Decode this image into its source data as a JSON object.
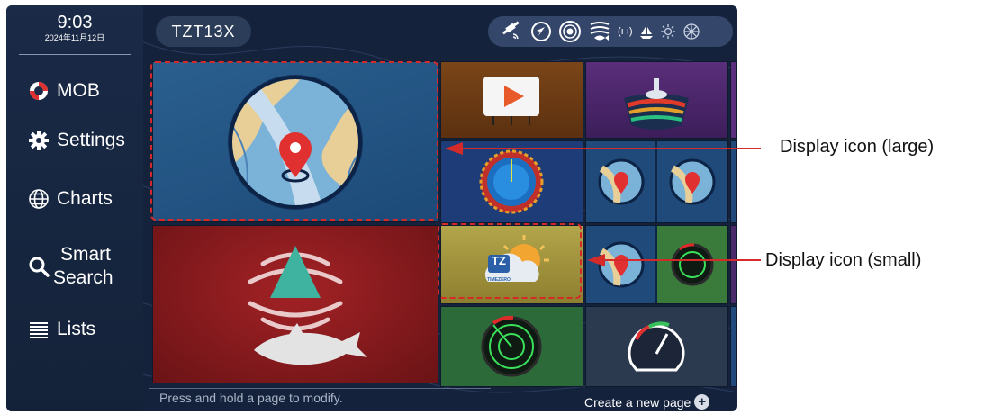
{
  "status": {
    "time": "9:03",
    "date": "2024年11月12日"
  },
  "sidebar": {
    "items": [
      {
        "label": "MOB",
        "icon": "lifebuoy-icon"
      },
      {
        "label": "Settings",
        "icon": "gear-icon"
      },
      {
        "label": "Charts",
        "icon": "globe-icon"
      },
      {
        "label_line1": "Smart",
        "label_line2": "Search",
        "icon": "search-icon"
      },
      {
        "label": "Lists",
        "icon": "list-icon"
      }
    ]
  },
  "header": {
    "device_name": "TZT13X",
    "status_icons": [
      "gps-satellite-icon",
      "navigation-arrow-icon",
      "sonar-target-icon",
      "fish-finder-icon",
      "signal-icon",
      "sail-icon",
      "sun-icon",
      "wheel-icon"
    ],
    "status_text": "(ı ı)"
  },
  "tiles": [
    {
      "name": "tile-chart-large",
      "icon": "chart-map-icon"
    },
    {
      "name": "tile-fishfinder-large",
      "icon": "fishfinder-fish-icon"
    },
    {
      "name": "tile-video",
      "icon": "video-play-icon"
    },
    {
      "name": "tile-3d-sonar",
      "icon": "sonar-3d-icon"
    },
    {
      "name": "tile-radar-overlay",
      "icon": "radar-overlay-icon"
    },
    {
      "name": "tile-dual-chart",
      "icon": "dual-chart-icon"
    },
    {
      "name": "tile-timezero-weather",
      "icon": "timezero-weather-icon",
      "logo_text": "TZ",
      "logo_sub": "TIMEZERO"
    },
    {
      "name": "tile-chart-radar",
      "icon": "chart-radar-icon"
    },
    {
      "name": "tile-radar",
      "icon": "radar-icon"
    },
    {
      "name": "tile-instruments",
      "icon": "gauge-icon"
    }
  ],
  "footer": {
    "hint": "Press and hold a page to modify.",
    "create_label": "Create a new page"
  },
  "callouts": {
    "large": "Display icon (large)",
    "small": "Display icon (small)"
  },
  "colors": {
    "background": "#14223c",
    "sidebar": "#1a2a47",
    "callout_dash": "#d42a2a",
    "fishfinder_tile": "#8a1a1d"
  }
}
